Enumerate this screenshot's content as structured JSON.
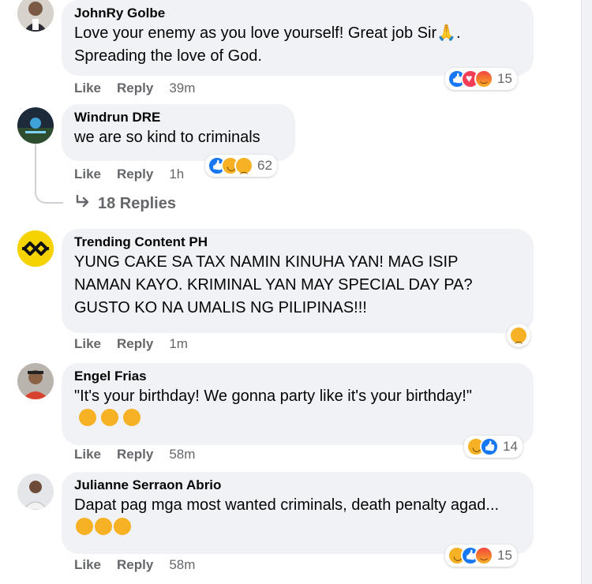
{
  "comments": [
    {
      "author": "JohnRy Golbe",
      "text": "Love your enemy as you love yourself! Great job Sir🙏.\nSpreading the love of God.",
      "like_label": "Like",
      "reply_label": "Reply",
      "time": "39m",
      "reaction_icons": [
        "like-icon",
        "love-icon",
        "angry-icon"
      ],
      "reaction_count": "15"
    },
    {
      "author": "Windrun DRE",
      "text": "we are so kind to criminals",
      "like_label": "Like",
      "reply_label": "Reply",
      "time": "1h",
      "reaction_icons": [
        "like-icon",
        "haha-icon",
        "sad-icon"
      ],
      "reaction_count": "62",
      "replies_label": "18 Replies"
    },
    {
      "author": "Trending Content PH",
      "text": "YUNG CAKE SA TAX NAMIN KINUHA YAN! MAG ISIP NAMAN KAYO. KRIMINAL YAN MAY SPECIAL DAY PA? GUSTO KO NA UMALIS NG PILIPINAS!!!",
      "like_label": "Like",
      "reply_label": "Reply",
      "time": "1m",
      "reaction_icons": [
        "sad-icon"
      ]
    },
    {
      "author": "Engel Frias",
      "text": "\"It's your birthday! We gonna party like it's your birthday!\"",
      "like_label": "Like",
      "reply_label": "Reply",
      "time": "58m",
      "reaction_icons": [
        "haha-icon",
        "like-icon"
      ],
      "reaction_count": "14"
    },
    {
      "author": "Julianne Serraon Abrio",
      "text": "Dapat pag mga most wanted criminals, death penalty agad...",
      "like_label": "Like",
      "reply_label": "Reply",
      "time": "58m",
      "reaction_icons": [
        "haha-icon",
        "like-icon",
        "angry-icon"
      ],
      "reaction_count": "15"
    }
  ],
  "colors": {
    "bubble": "#f0f2f5",
    "secondary_text": "#65676b",
    "like_blue": "#1877f2",
    "love_red": "#f33e58",
    "emoji_yellow": "#f7b125"
  }
}
